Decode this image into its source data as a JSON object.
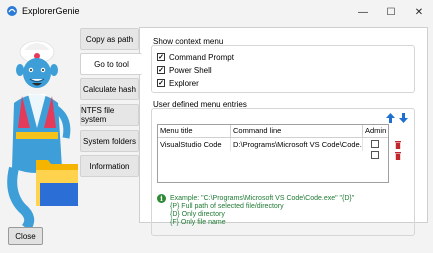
{
  "window": {
    "title": "ExplorerGenie",
    "minimize_glyph": "—",
    "maximize_glyph": "☐",
    "close_glyph": "✕"
  },
  "tabs": [
    {
      "label": "Copy as path"
    },
    {
      "label": "Go to tool"
    },
    {
      "label": "Calculate hash"
    },
    {
      "label": "NTFS file system"
    },
    {
      "label": "System folders"
    },
    {
      "label": "Information"
    }
  ],
  "context_menu": {
    "heading": "Show context menu",
    "items": [
      {
        "label": "Command Prompt",
        "checked": true
      },
      {
        "label": "Power Shell",
        "checked": true
      },
      {
        "label": "Explorer",
        "checked": true
      }
    ]
  },
  "user_entries": {
    "heading": "User defined menu entries",
    "columns": [
      "Menu title",
      "Command line",
      "Admin"
    ],
    "rows": [
      {
        "title": "VisualStudio Code",
        "command": "D:\\Programs\\Microsoft VS Code\\Code.exe",
        "admin": false
      },
      {
        "title": "",
        "command": "",
        "admin": false
      }
    ]
  },
  "hints": [
    "Example: \"C:\\Programs\\Microsoft VS Code\\Code.exe\" \"{D}\"",
    "{P} Full path of selected file/directory",
    "{D} Only directory",
    "{F} Only file name"
  ],
  "footer": {
    "close_label": "Close"
  },
  "colors": {
    "accent": "#1f6fd1",
    "hint_text": "#1f7a34",
    "delete": "#c0282d"
  },
  "icons": {
    "move_up": "arrow-up-icon",
    "move_down": "arrow-down-icon",
    "delete": "trash-icon",
    "info": "info-icon",
    "app": "genie-icon"
  }
}
